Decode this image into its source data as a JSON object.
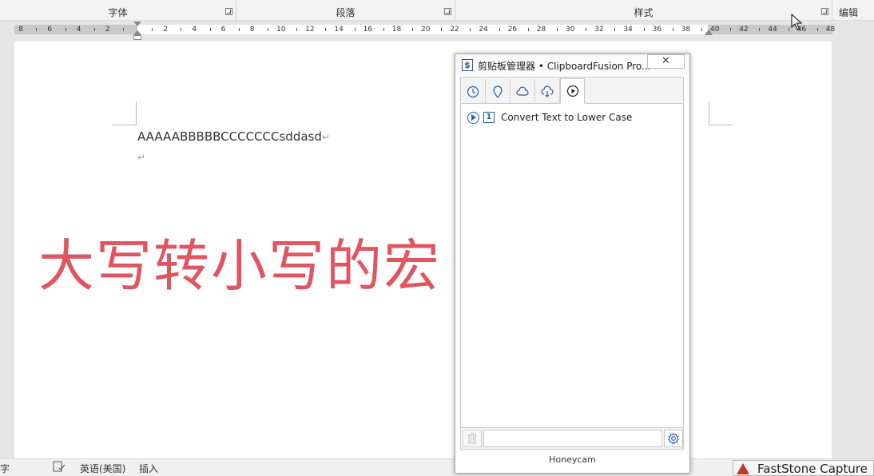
{
  "ribbon": {
    "groups": [
      {
        "label": "字体"
      },
      {
        "label": "段落"
      },
      {
        "label": "样式"
      },
      {
        "label": "编辑"
      }
    ]
  },
  "ruler": {
    "left_labels": [
      "8",
      "6",
      "4",
      "2"
    ],
    "right_labels": [
      "2",
      "4",
      "6",
      "8",
      "10",
      "12",
      "14",
      "16",
      "18",
      "20",
      "22",
      "24",
      "26",
      "28",
      "30",
      "32",
      "34",
      "36",
      "38",
      "40",
      "42",
      "44",
      "46",
      "48"
    ]
  },
  "document": {
    "line1": "AAAAABBBBBCCCCCCCsddasd",
    "paragraph_mark": "↵",
    "overlay_text": "大写转小写的宏"
  },
  "status_bar": {
    "word_count": "字",
    "language": "英语(美国)",
    "mode": "插入"
  },
  "clipboardfusion": {
    "title": "剪贴板管理器 • ClipboardFusion Pro...",
    "logo_glyph": "$",
    "close_glyph": "✕",
    "tabs": [
      {
        "name": "history-tab",
        "icon": "clock-icon"
      },
      {
        "name": "pinned-tab",
        "icon": "pin-icon"
      },
      {
        "name": "cloud-tab",
        "icon": "cloud-icon"
      },
      {
        "name": "cloud-sync-tab",
        "icon": "cloud-sync-icon"
      },
      {
        "name": "macros-tab",
        "icon": "play-icon",
        "active": true
      }
    ],
    "macro": {
      "number": "1",
      "label": "Convert Text to Lower Case"
    },
    "footer": "Honeycam"
  },
  "faststone": {
    "label": "FastStone Capture"
  },
  "colors": {
    "overlay_red": "#e05560",
    "cf_blue": "#2a5d9e"
  }
}
